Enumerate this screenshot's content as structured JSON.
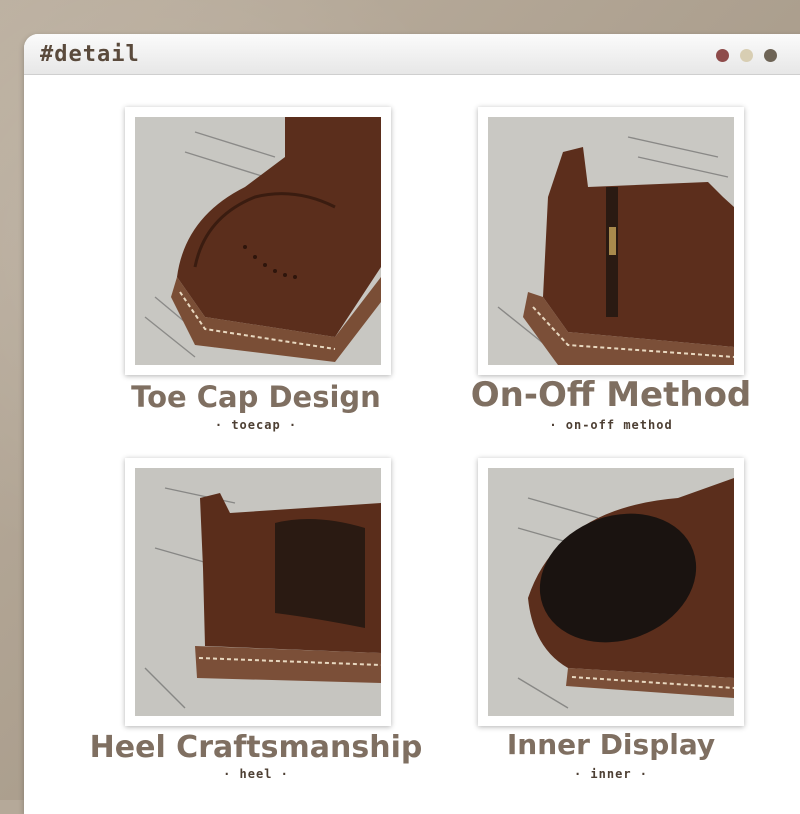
{
  "window": {
    "title": "#detail"
  },
  "panels": [
    {
      "title": "Toe Cap Design",
      "subtitle": "· toecap ·"
    },
    {
      "title": "On-Off Method",
      "subtitle": "· on-off method"
    },
    {
      "title": "Heel Craftsmanship",
      "subtitle": "· heel ·"
    },
    {
      "title": "Inner Display",
      "subtitle": "· inner ·"
    }
  ]
}
